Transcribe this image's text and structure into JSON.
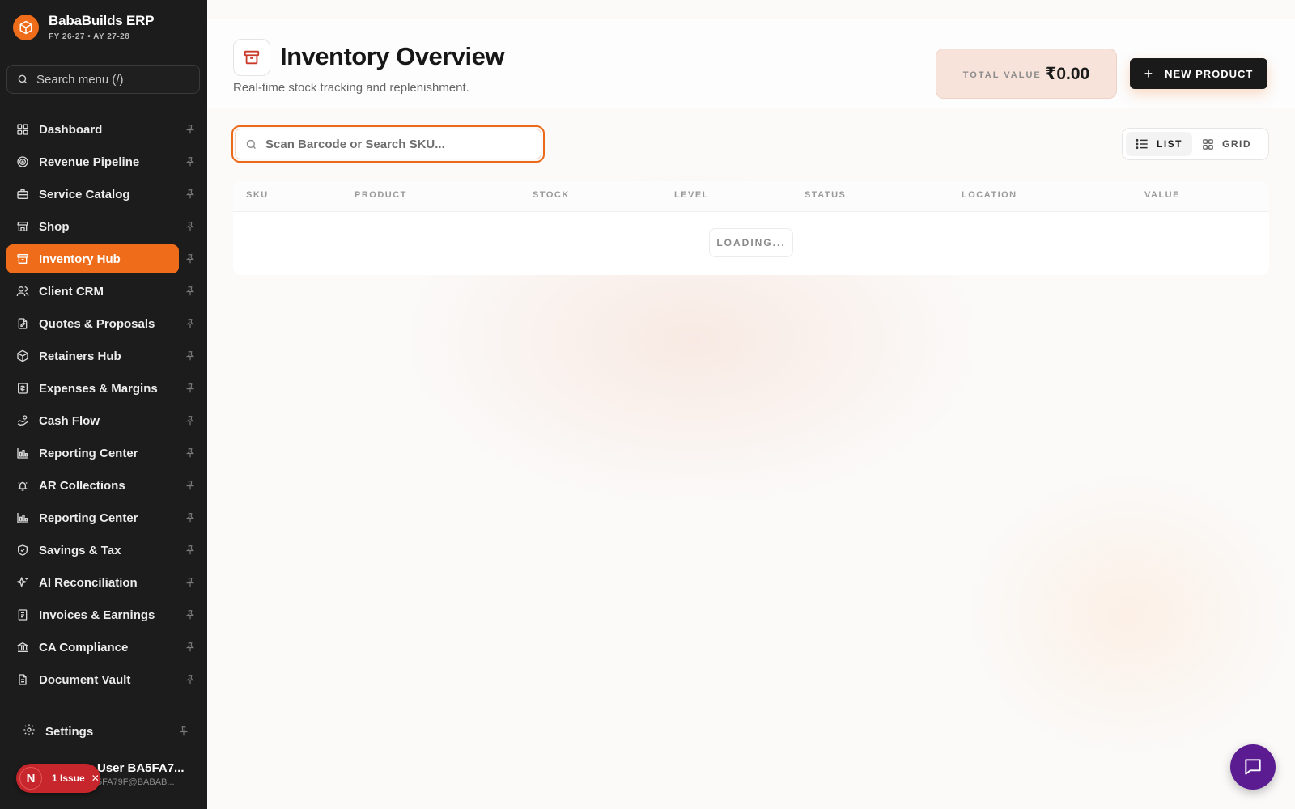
{
  "app": {
    "name": "BabaBuilds ERP",
    "fiscal": "FY 26-27 • AY 27-28"
  },
  "sidebar": {
    "search_placeholder": "Search menu (/)",
    "items": [
      {
        "label": "Dashboard",
        "icon": "grid-icon"
      },
      {
        "label": "Revenue Pipeline",
        "icon": "target-icon"
      },
      {
        "label": "Service Catalog",
        "icon": "briefcase-icon"
      },
      {
        "label": "Shop",
        "icon": "store-icon"
      },
      {
        "label": "Inventory Hub",
        "icon": "archive-icon",
        "active": true
      },
      {
        "label": "Client CRM",
        "icon": "users-icon"
      },
      {
        "label": "Quotes & Proposals",
        "icon": "file-edit-icon"
      },
      {
        "label": "Retainers Hub",
        "icon": "package-icon"
      },
      {
        "label": "Expenses & Margins",
        "icon": "receipt-icon"
      },
      {
        "label": "Cash Flow",
        "icon": "hand-coins-icon"
      },
      {
        "label": "Reporting Center",
        "icon": "bar-chart-icon"
      },
      {
        "label": "AR Collections",
        "icon": "alarm-icon"
      },
      {
        "label": "Reporting Center",
        "icon": "bar-chart-icon"
      },
      {
        "label": "Savings & Tax",
        "icon": "shield-icon"
      },
      {
        "label": "AI Reconciliation",
        "icon": "sparkles-icon"
      },
      {
        "label": "Invoices & Earnings",
        "icon": "invoice-icon"
      },
      {
        "label": "CA Compliance",
        "icon": "bank-icon"
      },
      {
        "label": "Document Vault",
        "icon": "document-icon"
      }
    ],
    "settings_label": "Settings",
    "user": {
      "name": "User BA5FA7...",
      "email": "5FA79F@BABAB..."
    },
    "issue": {
      "badge": "N",
      "label": "1 Issue",
      "close": "✕"
    }
  },
  "header": {
    "title": "Inventory Overview",
    "subtitle": "Real-time stock tracking and replenishment.",
    "total_label": "TOTAL VALUE",
    "total_value": "₹0.00",
    "new_button": "NEW PRODUCT"
  },
  "toolbar": {
    "scan_placeholder": "Scan Barcode or Search SKU...",
    "view_list": "LIST",
    "view_grid": "GRID",
    "active_view": "list"
  },
  "table": {
    "columns": [
      "SKU",
      "PRODUCT",
      "STOCK",
      "LEVEL",
      "STATUS",
      "LOCATION",
      "VALUE"
    ],
    "loading_text": "LOADING..."
  },
  "colors": {
    "accent": "#ef6c1a",
    "sidebar_bg": "#1c1c1c",
    "chat_button": "#5b1c92",
    "issue_badge": "#c6262c"
  }
}
